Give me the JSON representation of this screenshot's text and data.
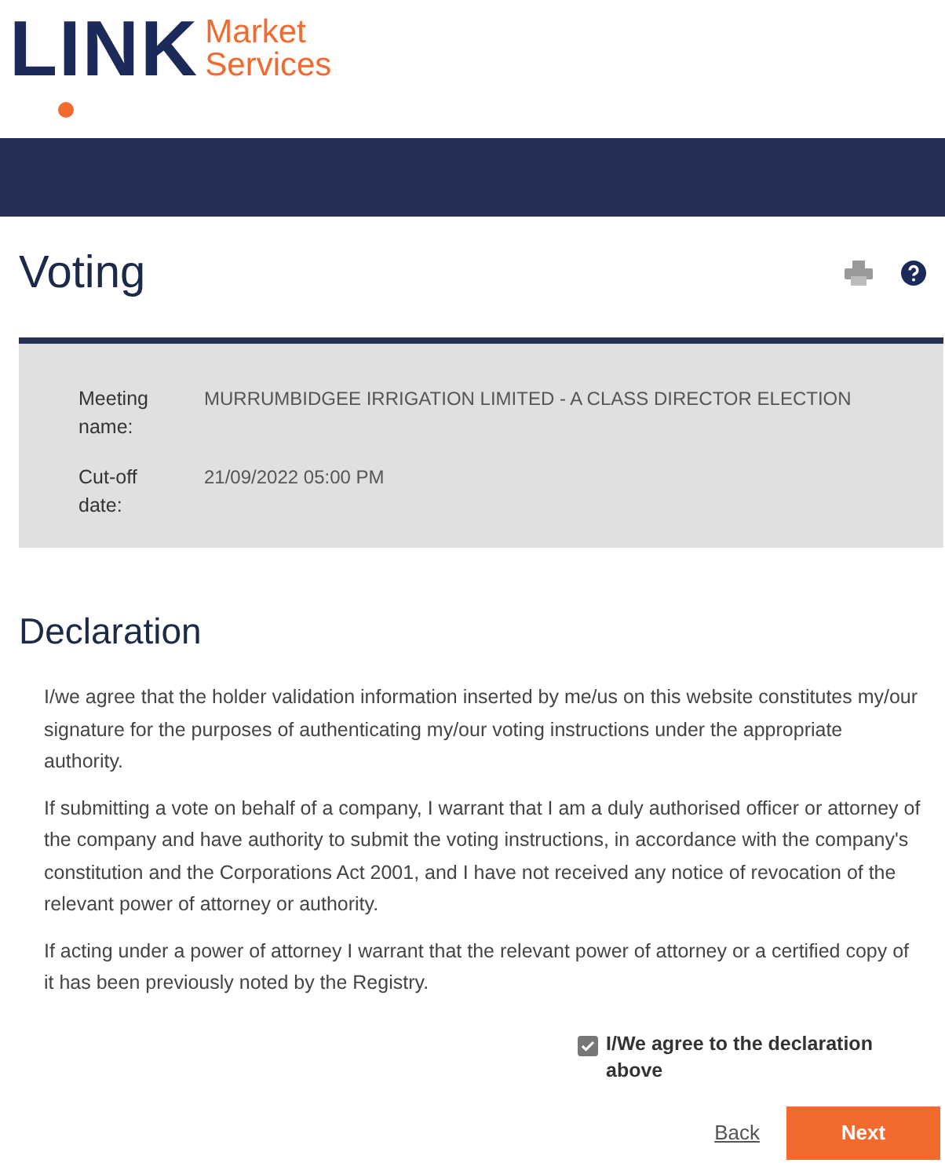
{
  "logo": {
    "wordmark": "LINK",
    "tagline_1": "Market",
    "tagline_2": "Services"
  },
  "page": {
    "title": "Voting"
  },
  "meeting": [
    {
      "label": "Meeting name:",
      "value": "MURRUMBIDGEE IRRIGATION LIMITED - A CLASS DIRECTOR ELECTION"
    },
    {
      "label": "Cut-off date:",
      "value": "21/09/2022 05:00 PM"
    }
  ],
  "declaration": {
    "heading": "Declaration",
    "paragraphs": [
      "I/we agree that the holder validation information inserted by me/us on this website constitutes my/our signature for the purposes of authenticating my/our voting instructions under the appropriate authority.",
      "If submitting a vote on behalf of a company, I warrant that I am a duly authorised officer or attorney of the company and have authority to submit the voting instructions, in accordance with the company's constitution and the Corporations Act 2001, and I have not received any notice of revocation of the relevant power of attorney or authority.",
      "If acting under a power of attorney I warrant that the relevant power of attorney or a certified copy of it has been previously noted by the Registry."
    ],
    "agree": {
      "label": "I/We agree to the declaration above",
      "checked": true
    }
  },
  "actions": {
    "back": "Back",
    "next": "Next"
  }
}
